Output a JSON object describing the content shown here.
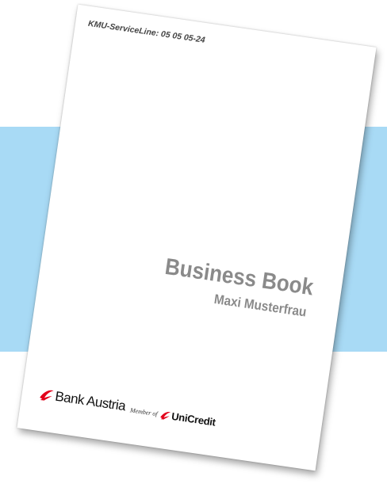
{
  "cover": {
    "serviceline": "KMU-ServiceLine: 05 05 05-24",
    "title": "Business Book",
    "subtitle": "Maxi Musterfrau"
  },
  "logos": {
    "bank_austria_text": "Bank Austria",
    "member_of_text": "Member of",
    "unicredit_text": "UniCredit"
  },
  "colors": {
    "background": "#ffffff",
    "band": "#a8daf5",
    "title_gray": "#8a8a8a",
    "brand_red": "#e2001a"
  },
  "icons": {
    "bank_austria_mark": "unicredit-swoosh-icon",
    "unicredit_mark": "unicredit-swoosh-icon"
  }
}
